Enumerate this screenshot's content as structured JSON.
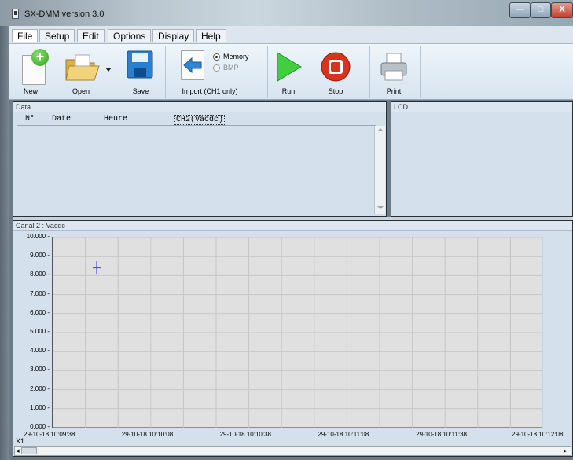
{
  "window": {
    "title": "SX-DMM version 3.0",
    "minimize": "—",
    "maximize": "□",
    "close": "X"
  },
  "menu": [
    "File",
    "Setup",
    "Edit",
    "Options",
    "Display",
    "Help"
  ],
  "toolbar": {
    "new": "New",
    "open": "Open",
    "save": "Save",
    "import": "Import (CH1 only)",
    "memory": "Memory",
    "bmp": "BMP",
    "run": "Run",
    "stop": "Stop",
    "print": "Print"
  },
  "data_panel": {
    "title": "Data",
    "columns": [
      "N°",
      "Date",
      "Heure",
      "CH2(Vacdc)"
    ],
    "rows": []
  },
  "lcd_panel": {
    "title": "LCD"
  },
  "chart_panel": {
    "title": "Canal 2 : Vacdc",
    "x_axis_label": "X1"
  },
  "chart_data": {
    "type": "line",
    "ylim": [
      0,
      10
    ],
    "y_ticks": [
      "10.000",
      "9.000",
      "8.000",
      "7.000",
      "6.000",
      "5.000",
      "4.000",
      "3.000",
      "2.000",
      "1.000",
      "0.000"
    ],
    "x_ticks": [
      "29-10-18 10:09:38",
      "29-10-18 10:10:08",
      "29-10-18 10:10:38",
      "29-10-18 10:11:08",
      "29-10-18 10:11:38",
      "29-10-18 10:12:08"
    ],
    "series": [],
    "grid": true
  },
  "scrollbar": {
    "left_arrow": "◂",
    "right_arrow": "▸"
  }
}
